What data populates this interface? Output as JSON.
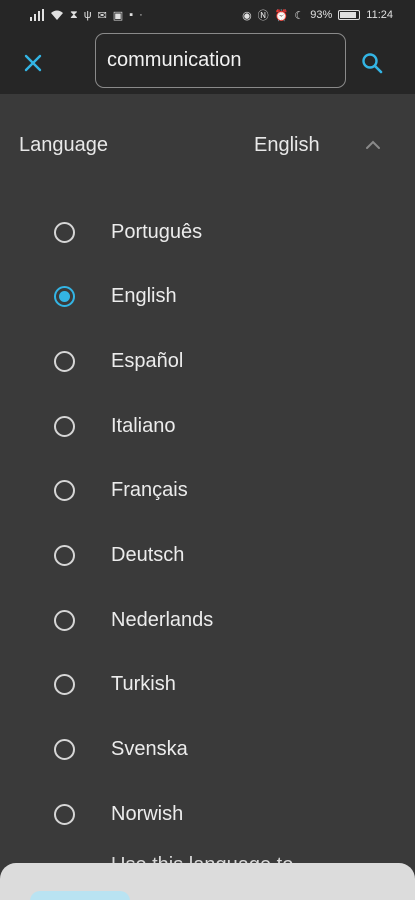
{
  "status_bar": {
    "battery": "93%",
    "time": "11:24",
    "battery_level": 0.93
  },
  "search": {
    "value": "communication"
  },
  "language": {
    "title": "Language",
    "current": "English",
    "options": [
      {
        "label": "Português",
        "selected": false
      },
      {
        "label": "English",
        "selected": true
      },
      {
        "label": "Español",
        "selected": false
      },
      {
        "label": "Italiano",
        "selected": false
      },
      {
        "label": "Français",
        "selected": false
      },
      {
        "label": "Deutsch",
        "selected": false
      },
      {
        "label": "Nederlands",
        "selected": false
      },
      {
        "label": "Turkish",
        "selected": false
      },
      {
        "label": "Svenska",
        "selected": false
      },
      {
        "label": "Norwish",
        "selected": false
      }
    ],
    "footer_text": "Use this language to"
  },
  "colors": {
    "accent": "#33b5e5",
    "background": "#3a3a3a",
    "header": "#262626"
  }
}
